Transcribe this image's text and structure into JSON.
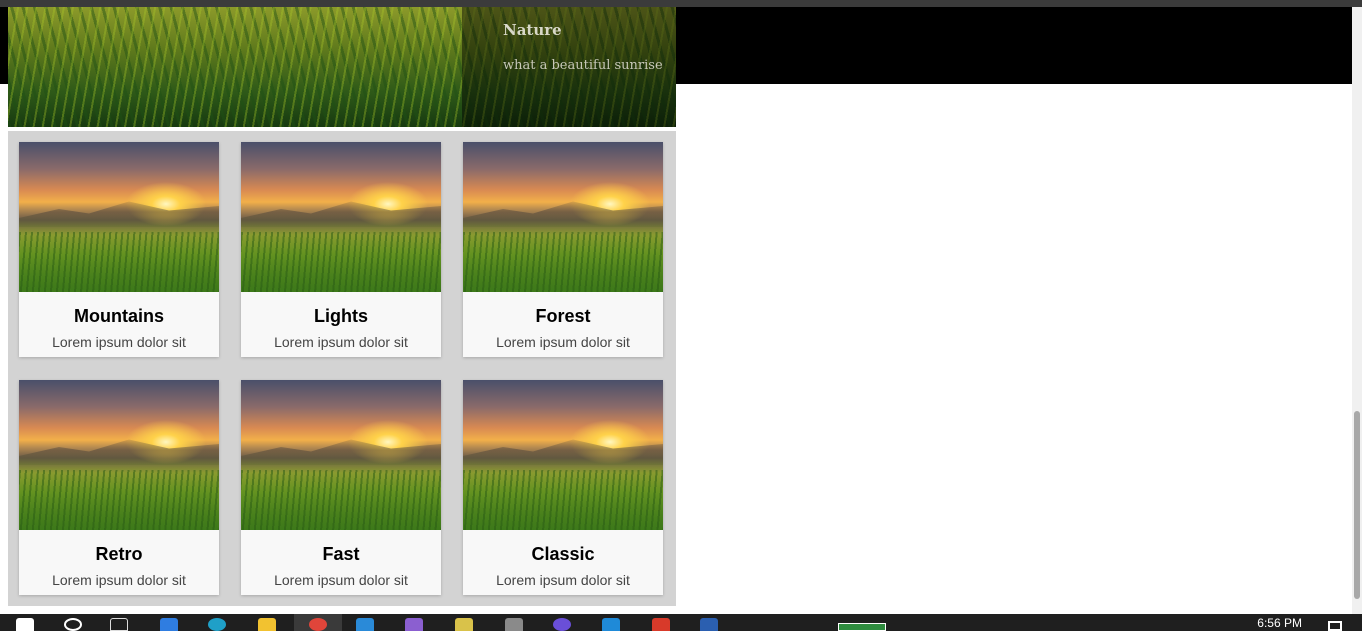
{
  "hero": {
    "title": "Nature",
    "subtitle": "what a beautiful sunrise"
  },
  "gallery": {
    "cards": [
      {
        "title": "Mountains",
        "desc": "Lorem ipsum dolor sit"
      },
      {
        "title": "Lights",
        "desc": "Lorem ipsum dolor sit"
      },
      {
        "title": "Forest",
        "desc": "Lorem ipsum dolor sit"
      },
      {
        "title": "Retro",
        "desc": "Lorem ipsum dolor sit"
      },
      {
        "title": "Fast",
        "desc": "Lorem ipsum dolor sit"
      },
      {
        "title": "Classic",
        "desc": "Lorem ipsum dolor sit"
      }
    ]
  },
  "taskbar": {
    "clock": "6:56 PM",
    "icons": [
      "start-icon",
      "search-icon",
      "task-view-icon",
      "edge-icon",
      "edge-dev-icon",
      "file-explorer-icon",
      "chrome-icon",
      "store-icon",
      "visual-studio-icon",
      "app-icon",
      "app-icon-2",
      "app-icon-3",
      "vscode-icon",
      "app-icon-4",
      "word-icon"
    ],
    "colors": {
      "taskbar": "#1f1f1f",
      "battery": "#2e8b3e"
    }
  }
}
